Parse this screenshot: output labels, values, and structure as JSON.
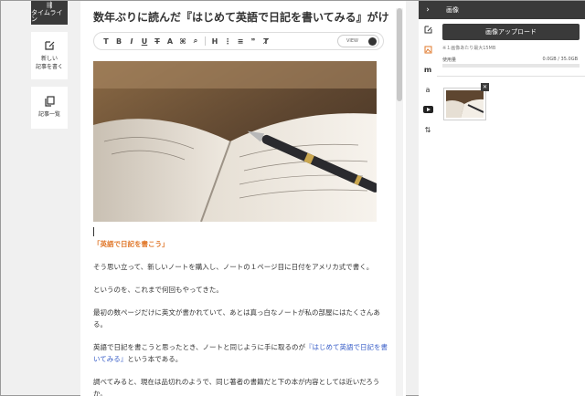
{
  "left_nav": {
    "timeline_label": "タイムライン",
    "new_post_label_line1": "新しい",
    "new_post_label_line2": "記事を書く",
    "post_list_label": "記事一覧"
  },
  "editor": {
    "title": "数年ぶりに読んだ『はじめて英語で日記を書いてみる』がけ",
    "view_label": "VIEW",
    "toolbar_buttons": [
      "T",
      "B",
      "I",
      "U",
      "T",
      "A",
      "⌘",
      "⌕",
      "H",
      "⋮",
      "≡",
      "❞",
      "Ⱦ"
    ],
    "heading": "「英語で日記を書こう」",
    "paragraphs": [
      "そう思い立って、新しいノートを購入し、ノートの１ページ目に日付をアメリカ式で書く。",
      "というのを、これまで何回もやってきた。",
      "最初の数ページだけに英文が書かれていて、あとは真っ白なノートが私の部屋にはたくさんある。"
    ],
    "para4_before": "英語で日記を書こうと思ったとき、ノートと同じように手に取るのが",
    "para4_link": "『はじめて英語で日記を書いてみる』",
    "para4_after": "という本である。",
    "para5": "調べてみると、現在は品切れのようで、同じ著者の書籍だと下の本が内容としては近いだろうか。"
  },
  "right_panel": {
    "header": "画像",
    "upload_button": "画像アップロード",
    "max_note": "※１画像あたり最大15MB",
    "usage_label": "使用量",
    "usage_value": "0.0GB / 35.0GB",
    "usage_fraction": 0.0
  },
  "colors": {
    "dark": "#3a3a3a",
    "heading_orange": "#e0782b",
    "link_blue": "#3a5fc8"
  }
}
